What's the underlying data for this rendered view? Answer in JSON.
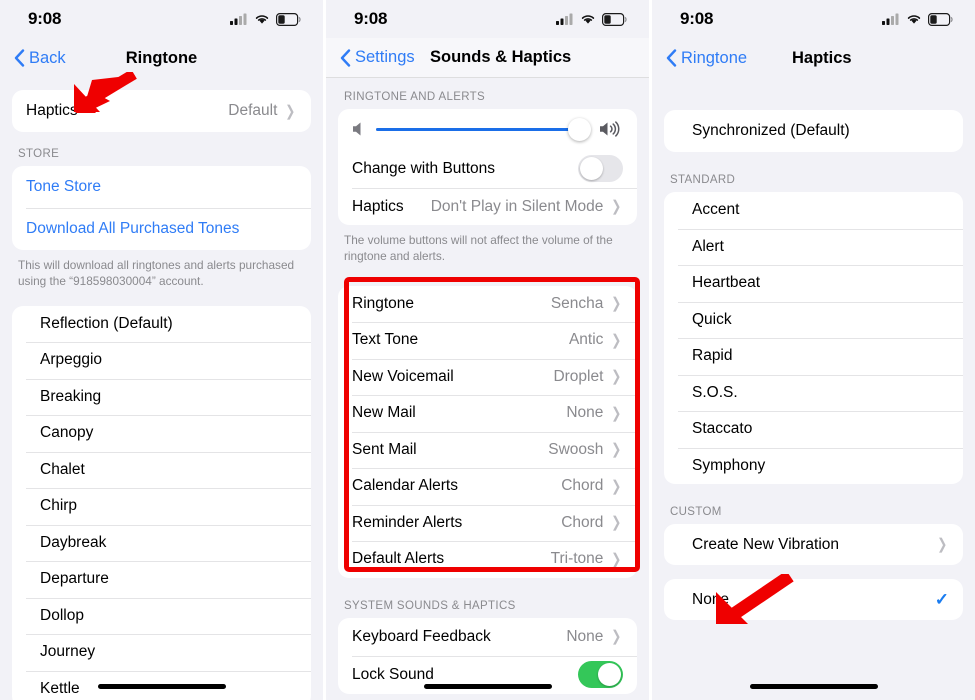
{
  "status": {
    "time": "9:08",
    "icons": [
      "cellular-signal-icon",
      "wifi-icon",
      "battery-icon"
    ]
  },
  "colors": {
    "accent_blue": "#2f7cf6",
    "highlight_red": "#ef0000",
    "toggle_green": "#34c759",
    "slider_blue": "#1a6ee8",
    "bg_gray": "#f2f2f7"
  },
  "panel1": {
    "nav": {
      "back_label": "Back",
      "title": "Ringtone"
    },
    "haptics_row": {
      "label": "Haptics",
      "value": "Default"
    },
    "store_header": "STORE",
    "store_items": [
      {
        "label": "Tone Store"
      },
      {
        "label": "Download All Purchased Tones"
      }
    ],
    "store_footnote": "This will download all ringtones and alerts purchased using the “918598030004” account.",
    "tones": [
      "Reflection (Default)",
      "Arpeggio",
      "Breaking",
      "Canopy",
      "Chalet",
      "Chirp",
      "Daybreak",
      "Departure",
      "Dollop",
      "Journey",
      "Kettle"
    ]
  },
  "panel2": {
    "nav": {
      "back_label": "Settings",
      "title": "Sounds & Haptics"
    },
    "ringtone_alerts_header": "RINGTONE AND ALERTS",
    "volume": {
      "level_percent": 95,
      "low_icon": "speaker-low-icon",
      "high_icon": "speaker-high-icon"
    },
    "change_with_buttons": {
      "label": "Change with Buttons",
      "state": "off"
    },
    "haptics_row": {
      "label": "Haptics",
      "value": "Don't Play in Silent Mode"
    },
    "footnote": "The volume buttons will not affect the volume of the ringtone and alerts.",
    "tone_rows": [
      {
        "label": "Ringtone",
        "value": "Sencha"
      },
      {
        "label": "Text Tone",
        "value": "Antic"
      },
      {
        "label": "New Voicemail",
        "value": "Droplet"
      },
      {
        "label": "New Mail",
        "value": "None"
      },
      {
        "label": "Sent Mail",
        "value": "Swoosh"
      },
      {
        "label": "Calendar Alerts",
        "value": "Chord"
      },
      {
        "label": "Reminder Alerts",
        "value": "Chord"
      },
      {
        "label": "Default Alerts",
        "value": "Tri-tone"
      }
    ],
    "system_header": "SYSTEM SOUNDS & HAPTICS",
    "system_rows": [
      {
        "label": "Keyboard Feedback",
        "value": "None",
        "type": "chevron"
      },
      {
        "label": "Lock Sound",
        "value": "",
        "type": "toggle-on"
      }
    ]
  },
  "panel3": {
    "nav": {
      "back_label": "Ringtone",
      "title": "Haptics"
    },
    "default_row": {
      "label": "Synchronized (Default)"
    },
    "standard_header": "STANDARD",
    "standard_items": [
      "Accent",
      "Alert",
      "Heartbeat",
      "Quick",
      "Rapid",
      "S.O.S.",
      "Staccato",
      "Symphony"
    ],
    "custom_header": "CUSTOM",
    "create_row": {
      "label": "Create New Vibration"
    },
    "none_row": {
      "label": "None",
      "selected": true
    }
  }
}
